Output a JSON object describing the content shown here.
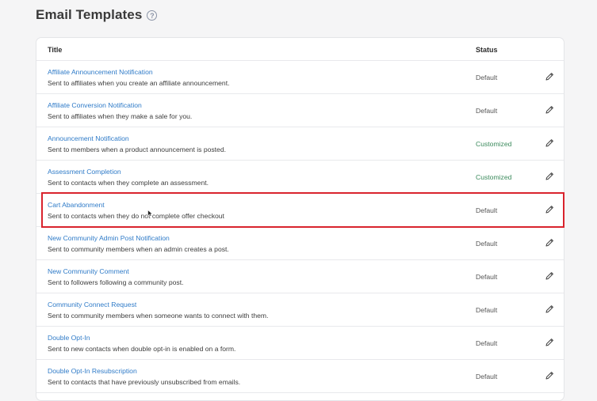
{
  "page": {
    "title": "Email Templates",
    "help_icon": "question-circle-icon"
  },
  "table": {
    "columns": {
      "title": "Title",
      "status": "Status"
    },
    "rows": [
      {
        "name": "Affiliate Announcement Notification",
        "description": "Sent to affiliates when you create an affiliate announcement.",
        "status": "Default"
      },
      {
        "name": "Affiliate Conversion Notification",
        "description": "Sent to affiliates when they make a sale for you.",
        "status": "Default"
      },
      {
        "name": "Announcement Notification",
        "description": "Sent to members when a product announcement is posted.",
        "status": "Customized"
      },
      {
        "name": "Assessment Completion",
        "description": "Sent to contacts when they complete an assessment.",
        "status": "Customized"
      },
      {
        "name": "Cart Abandonment",
        "description": "Sent to contacts when they do not complete offer checkout",
        "status": "Default"
      },
      {
        "name": "New Community Admin Post Notification",
        "description": "Sent to community members when an admin creates a post.",
        "status": "Default"
      },
      {
        "name": "New Community Comment",
        "description": "Sent to followers following a community post.",
        "status": "Default"
      },
      {
        "name": "Community Connect Request",
        "description": "Sent to community members when someone wants to connect with them.",
        "status": "Default"
      },
      {
        "name": "Double Opt-In",
        "description": "Sent to new contacts when double opt-in is enabled on a form.",
        "status": "Default"
      },
      {
        "name": "Double Opt-In Resubscription",
        "description": "Sent to contacts that have previously unsubscribed from emails.",
        "status": "Default"
      }
    ],
    "edit_icon": "pencil-icon"
  },
  "colors": {
    "link": "#2f7bc8",
    "customized": "#3b8a5c",
    "highlight": "#d9232d"
  }
}
